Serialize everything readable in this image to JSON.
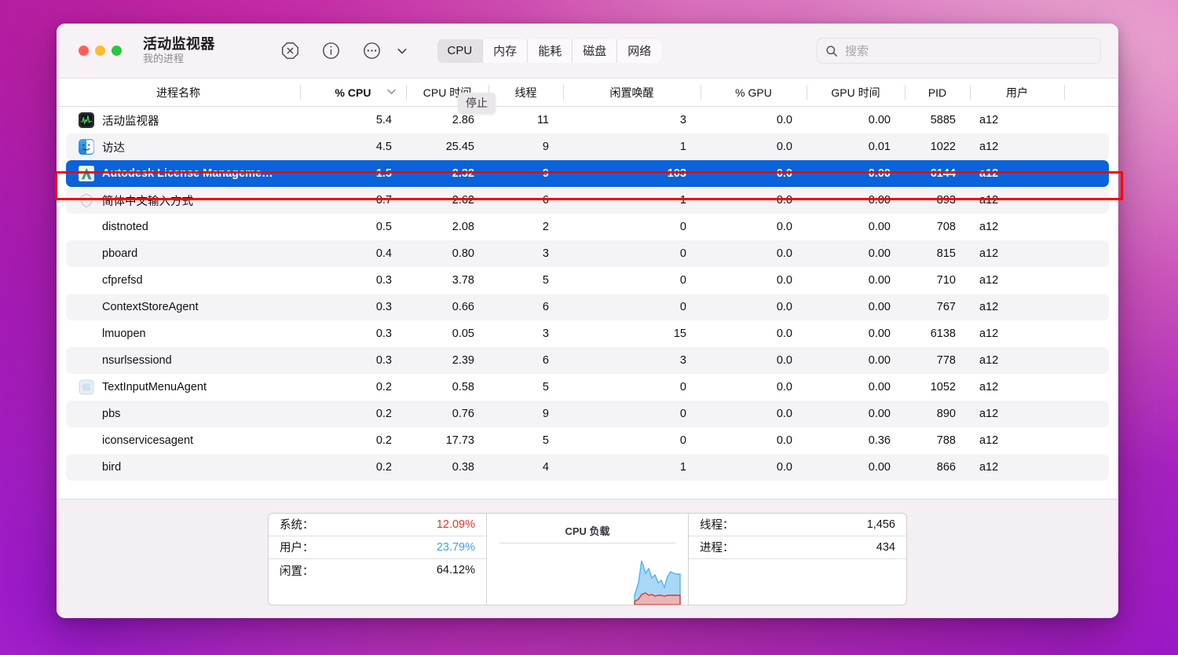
{
  "window": {
    "title": "活动监视器",
    "subtitle": "我的进程",
    "traffic_lights": [
      "close",
      "minimize",
      "zoom"
    ]
  },
  "toolbar": {
    "icons": [
      {
        "name": "stop-process-icon",
        "glyph": "octagon-x"
      },
      {
        "name": "inspect-process-icon",
        "glyph": "info-circle"
      },
      {
        "name": "more-options-icon",
        "glyph": "ellipsis-circle"
      },
      {
        "name": "chevron-down-icon",
        "glyph": "chevron-down"
      }
    ],
    "tabs": [
      {
        "label": "CPU",
        "active": true
      },
      {
        "label": "内存",
        "active": false
      },
      {
        "label": "能耗",
        "active": false
      },
      {
        "label": "磁盘",
        "active": false
      },
      {
        "label": "网络",
        "active": false
      }
    ],
    "search": {
      "placeholder": "搜索",
      "value": ""
    },
    "tooltip": "停止"
  },
  "table": {
    "columns": [
      {
        "key": "name",
        "label": "进程名称",
        "sorted": false
      },
      {
        "key": "cpu",
        "label": "% CPU",
        "sorted": true
      },
      {
        "key": "cputime",
        "label": "CPU 时间",
        "sorted": false
      },
      {
        "key": "threads",
        "label": "线程",
        "sorted": false
      },
      {
        "key": "idle",
        "label": "闲置唤醒",
        "sorted": false
      },
      {
        "key": "gpu",
        "label": "% GPU",
        "sorted": false
      },
      {
        "key": "gputime",
        "label": "GPU 时间",
        "sorted": false
      },
      {
        "key": "pid",
        "label": "PID",
        "sorted": false
      },
      {
        "key": "user",
        "label": "用户",
        "sorted": false
      }
    ],
    "sort_indicator": "chevron-down",
    "rows": [
      {
        "icon": "activity-monitor-icon",
        "name": "活动监视器",
        "cpu": "5.4",
        "cputime": "2.86",
        "threads": "11",
        "idle": "3",
        "gpu": "0.0",
        "gputime": "0.00",
        "pid": "5885",
        "user": "a12",
        "selected": false
      },
      {
        "icon": "finder-icon",
        "name": "访达",
        "cpu": "4.5",
        "cputime": "25.45",
        "threads": "9",
        "idle": "1",
        "gpu": "0.0",
        "gputime": "0.01",
        "pid": "1022",
        "user": "a12",
        "selected": false
      },
      {
        "icon": "autodesk-icon",
        "name": "Autodesk License Manageme…",
        "cpu": "1.5",
        "cputime": "2.32",
        "threads": "9",
        "idle": "103",
        "gpu": "0.0",
        "gputime": "0.00",
        "pid": "6144",
        "user": "a12",
        "selected": true
      },
      {
        "icon": "shield-icon",
        "name": "简体中文输入方式",
        "cpu": "0.7",
        "cputime": "2.62",
        "threads": "6",
        "idle": "1",
        "gpu": "0.0",
        "gputime": "0.00",
        "pid": "893",
        "user": "a12",
        "selected": false
      },
      {
        "icon": "none",
        "name": "distnoted",
        "cpu": "0.5",
        "cputime": "2.08",
        "threads": "2",
        "idle": "0",
        "gpu": "0.0",
        "gputime": "0.00",
        "pid": "708",
        "user": "a12",
        "selected": false
      },
      {
        "icon": "none",
        "name": "pboard",
        "cpu": "0.4",
        "cputime": "0.80",
        "threads": "3",
        "idle": "0",
        "gpu": "0.0",
        "gputime": "0.00",
        "pid": "815",
        "user": "a12",
        "selected": false
      },
      {
        "icon": "none",
        "name": "cfprefsd",
        "cpu": "0.3",
        "cputime": "3.78",
        "threads": "5",
        "idle": "0",
        "gpu": "0.0",
        "gputime": "0.00",
        "pid": "710",
        "user": "a12",
        "selected": false
      },
      {
        "icon": "none",
        "name": "ContextStoreAgent",
        "cpu": "0.3",
        "cputime": "0.66",
        "threads": "6",
        "idle": "0",
        "gpu": "0.0",
        "gputime": "0.00",
        "pid": "767",
        "user": "a12",
        "selected": false
      },
      {
        "icon": "none",
        "name": "lmuopen",
        "cpu": "0.3",
        "cputime": "0.05",
        "threads": "3",
        "idle": "15",
        "gpu": "0.0",
        "gputime": "0.00",
        "pid": "6138",
        "user": "a12",
        "selected": false
      },
      {
        "icon": "none",
        "name": "nsurlsessiond",
        "cpu": "0.3",
        "cputime": "2.39",
        "threads": "6",
        "idle": "3",
        "gpu": "0.0",
        "gputime": "0.00",
        "pid": "778",
        "user": "a12",
        "selected": false
      },
      {
        "icon": "text-input-menu-icon",
        "name": "TextInputMenuAgent",
        "cpu": "0.2",
        "cputime": "0.58",
        "threads": "5",
        "idle": "0",
        "gpu": "0.0",
        "gputime": "0.00",
        "pid": "1052",
        "user": "a12",
        "selected": false
      },
      {
        "icon": "none",
        "name": "pbs",
        "cpu": "0.2",
        "cputime": "0.76",
        "threads": "9",
        "idle": "0",
        "gpu": "0.0",
        "gputime": "0.00",
        "pid": "890",
        "user": "a12",
        "selected": false
      },
      {
        "icon": "none",
        "name": "iconservicesagent",
        "cpu": "0.2",
        "cputime": "17.73",
        "threads": "5",
        "idle": "0",
        "gpu": "0.0",
        "gputime": "0.36",
        "pid": "788",
        "user": "a12",
        "selected": false
      },
      {
        "icon": "none",
        "name": "bird",
        "cpu": "0.2",
        "cputime": "0.38",
        "threads": "4",
        "idle": "1",
        "gpu": "0.0",
        "gputime": "0.00",
        "pid": "866",
        "user": "a12",
        "selected": false
      }
    ]
  },
  "status": {
    "left": [
      {
        "label": "系统：",
        "value": "12.09%",
        "color": "#e0342c"
      },
      {
        "label": "用户：",
        "value": "23.79%",
        "color": "#3ba3e8"
      },
      {
        "label": "闲置：",
        "value": "64.12%",
        "color": "#141416"
      }
    ],
    "graph": {
      "title": "CPU 负载",
      "user_color": "#49b4f0",
      "system_color": "#e0342c"
    },
    "right": [
      {
        "label": "线程：",
        "value": "1,456"
      },
      {
        "label": "进程：",
        "value": "434"
      }
    ]
  },
  "annotation": {
    "color": "#ff0000",
    "target_row": "Autodesk License Manageme…"
  }
}
